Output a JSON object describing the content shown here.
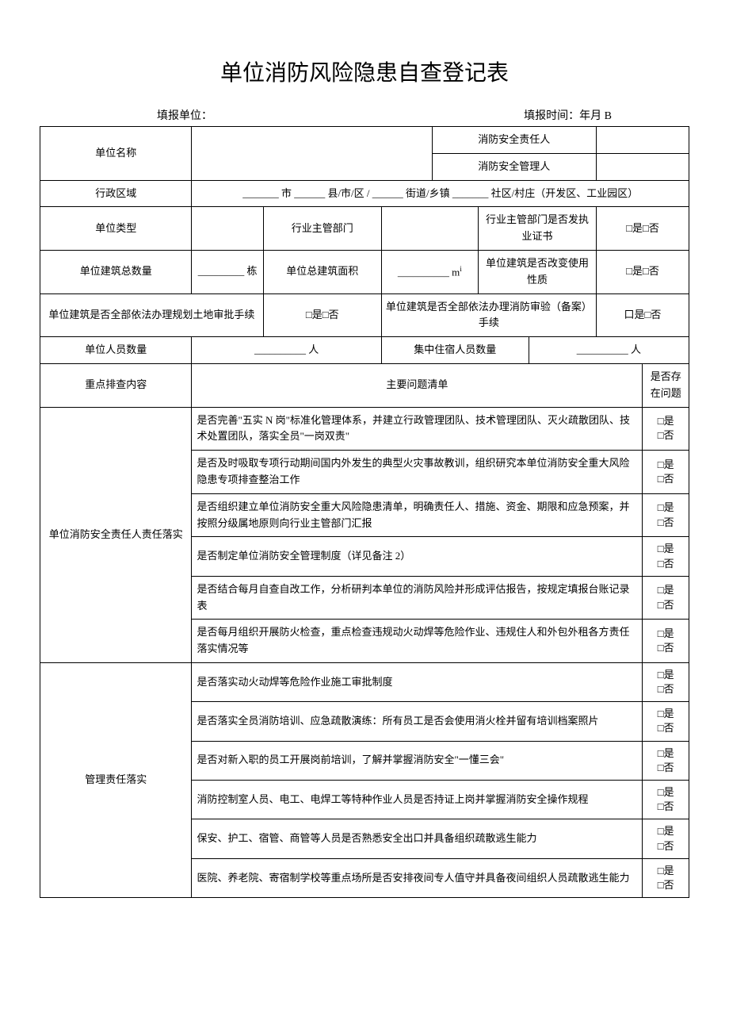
{
  "title": "单位消防风险隐患自查登记表",
  "meta": {
    "unit_label": "填报单位：",
    "time_label": "填报时间：年月 B"
  },
  "labels": {
    "unit_name": "单位名称",
    "safety_person": "消防安全责任人",
    "safety_manager": "消防安全管理人",
    "region": "行政区域",
    "region_template": "_______ 市 ______ 县/市/区 / ______ 街道/乡镇 _______ 社区/村庄（开发区、工业园区）",
    "unit_type": "单位类型",
    "industry_dept": "行业主管部门",
    "license_q": "行业主管部门是否发执业证书",
    "yesno": "□是□否",
    "building_count": "单位建筑总数量",
    "building_count_val": "_________ 栋",
    "total_area": "单位总建筑面积",
    "total_area_val": "__________ m",
    "use_change_q": "单位建筑是否改变使用性质",
    "land_approval_q": "单位建筑是否全部依法办理规划土地审批手续",
    "fire_review_q": "单位建筑是否全部依法办理消防审验（备案）手续",
    "yesno2": "口是□否",
    "staff_count": "单位人员数量",
    "staff_count_val": "__________ 人",
    "lodging_count": "集中住宿人员数量",
    "lodging_count_val": "__________ 人",
    "key_content": "重点排查内容",
    "main_list": "主要问题清单",
    "exist_q": "是否存在问题",
    "yes": "□是",
    "no": "□否"
  },
  "section1": {
    "header": "单位消防安全责任人责任落实",
    "items": [
      "是否完善\"五实 N 岗\"标准化管理体系，并建立行政管理团队、技术管理团队、灭火疏散团队、技术处置团队，落实全员\"一岗双责\"",
      "是否及时吸取专项行动期间国内外发生的典型火灾事故教训，组织研究本单位消防安全重大风险隐患专项排查整治工作",
      "是否组织建立单位消防安全重大风险隐患清单，明确责任人、措施、资金、期限和应急预案，并按照分级属地原则向行业主管部门汇报",
      "是否制定单位消防安全管理制度（详见备注 2）",
      "是否结合每月自查自改工作，分析研判本单位的消防风险并形成评估报告，按规定填报台账记录表",
      "是否每月组织开展防火检查，重点检查违规动火动焊等危险作业、违规住人和外包外租各方责任落实情况等"
    ]
  },
  "section2": {
    "header": "管理责任落实",
    "items": [
      "是否落实动火动焊等危险作业施工审批制度",
      "是否落实全员消防培训、应急疏散演练：所有员工是否会使用消火栓并留有培训档案照片",
      "是否对新入职的员工开展岗前培训，了解并掌握消防安全\"一懂三会\"",
      "消防控制室人员、电工、电焊工等特种作业人员是否持证上岗并掌握消防安全操作规程",
      "保安、护工、宿管、商管等人员是否熟悉安全出口并具备组织疏散逃生能力",
      "医院、养老院、寄宿制学校等重点场所是否安排夜间专人值守并具备夜间组织人员疏散逃生能力"
    ]
  }
}
